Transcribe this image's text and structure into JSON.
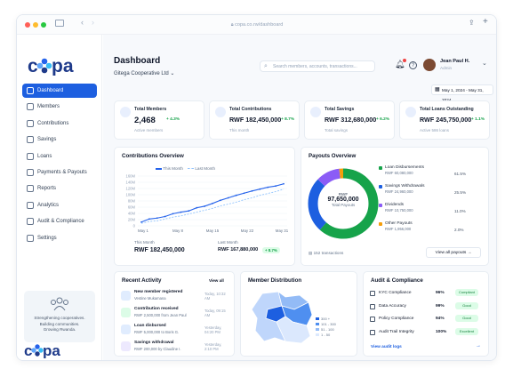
{
  "browser": {
    "url": "copa.co.rw/dashboard"
  },
  "brand": {
    "logo": "copa",
    "accent": "#1d5fe0"
  },
  "sidebar": {
    "items": [
      {
        "label": "Dashboard",
        "icon": "home-icon"
      },
      {
        "label": "Members",
        "icon": "users-icon"
      },
      {
        "label": "Contributions",
        "icon": "coins-icon"
      },
      {
        "label": "Savings",
        "icon": "piggy-bank-icon"
      },
      {
        "label": "Loans",
        "icon": "loan-icon"
      },
      {
        "label": "Payments & Payouts",
        "icon": "card-icon"
      },
      {
        "label": "Reports",
        "icon": "report-icon"
      },
      {
        "label": "Analytics",
        "icon": "analytics-icon"
      },
      {
        "label": "Audit & Compliance",
        "icon": "shield-icon"
      },
      {
        "label": "Settings",
        "icon": "gear-icon"
      }
    ],
    "promo": {
      "line1": "Strengthening cooperatives.",
      "line2": "Building communities.",
      "line3": "Growing Rwanda."
    }
  },
  "header": {
    "title": "Dashboard",
    "org": "Gitega Cooperative Ltd",
    "search_placeholder": "Search members, accounts, transactions...",
    "user_name": "Jean Paul H.",
    "user_role": "Admin",
    "date_range": "May 1, 2024 - May 31, 2024"
  },
  "stats": [
    {
      "title": "Total Members",
      "value": "2,468",
      "change": "+ 4.3%",
      "sub": "Active members"
    },
    {
      "title": "Total Contributions",
      "value": "RWF 182,450,000",
      "change": "+ 8.7%",
      "sub": "This month"
    },
    {
      "title": "Total Savings",
      "value": "RWF 312,680,000",
      "change": "+ 6.2%",
      "sub": "Total savings"
    },
    {
      "title": "Total Loans Outstanding",
      "value": "RWF 245,750,000",
      "change": "+ 1.1%",
      "sub": "Active 586 loans"
    }
  ],
  "contributions": {
    "title": "Contributions Overview",
    "legend_this": "This Month",
    "legend_last": "Last Month",
    "this_label": "This Month",
    "this_value": "RWF 182,450,000",
    "last_label": "Last Month",
    "last_value": "RWF 167,880,000",
    "change": "+ 8.7%"
  },
  "chart_data": {
    "type": "line",
    "x": [
      "May 1",
      "May 8",
      "May 15",
      "May 22",
      "May 31"
    ],
    "yticks": [
      "0",
      "20M",
      "40M",
      "60M",
      "80M",
      "100M",
      "120M",
      "140M",
      "160M"
    ],
    "ylim": [
      0,
      160
    ],
    "series": [
      {
        "name": "This Month",
        "color": "#2563eb",
        "values": [
          12,
          22,
          25,
          30,
          39,
          44,
          48,
          58,
          63,
          72,
          82,
          90,
          98,
          105,
          112,
          118,
          124,
          128,
          135
        ]
      },
      {
        "name": "Last Month",
        "color": "#93c5fd",
        "values": [
          8,
          14,
          16,
          22,
          28,
          32,
          38,
          44,
          50,
          56,
          64,
          70,
          76,
          84,
          90,
          98,
          104,
          110,
          118
        ]
      }
    ]
  },
  "payouts": {
    "title": "Payouts Overview",
    "center_label": "RWF",
    "center_value": "97,650,000",
    "center_sub": "Total Payouts",
    "transactions": "152 transactions",
    "button": "View all payouts",
    "items": [
      {
        "name": "Loan Disbursements",
        "amount": "RWF 60,080,000",
        "pct": "61.5%",
        "value": 61.5,
        "color": "#16a34a"
      },
      {
        "name": "Savings Withdrawals",
        "amount": "RWF 24,960,000",
        "pct": "25.5%",
        "value": 25.5,
        "color": "#1d5fe0"
      },
      {
        "name": "Dividends",
        "amount": "RWF 10,750,000",
        "pct": "11.0%",
        "value": 11.0,
        "color": "#8b5cf6"
      },
      {
        "name": "Other Payouts",
        "amount": "RWF 1,956,000",
        "pct": "2.0%",
        "value": 2.0,
        "color": "#f59e0b"
      }
    ]
  },
  "activity": {
    "title": "Recent Activity",
    "view_all": "View all",
    "items": [
      {
        "title": "New member registered",
        "sub": "Vestine Mukamana",
        "time": "Today, 10:32 AM"
      },
      {
        "title": "Contribution received",
        "sub": "RWF 2,500,000 from Jean Paul",
        "time": "Today, 09:15 AM"
      },
      {
        "title": "Loan disbursed",
        "sub": "RWF 5,000,000 to Boris G.",
        "time": "Yesterday, 04:20 PM"
      },
      {
        "title": "Savings withdrawal",
        "sub": "RWF 200,000 by Claudine I.",
        "time": "Yesterday, 2:10 PM"
      }
    ]
  },
  "distribution": {
    "title": "Member Distribution",
    "legend": [
      "300 +",
      "101 - 300",
      "51 - 100",
      "1 - 50"
    ]
  },
  "audit": {
    "title": "Audit & Compliance",
    "link": "View audit logs",
    "items": [
      {
        "name": "KYC Compliance",
        "pct": "96%",
        "badge": "Compliant"
      },
      {
        "name": "Data Accuracy",
        "pct": "99%",
        "badge": "Good"
      },
      {
        "name": "Policy Compliance",
        "pct": "94%",
        "badge": "Good"
      },
      {
        "name": "Audit Trail Integrity",
        "pct": "100%",
        "badge": "Excellent"
      }
    ]
  }
}
